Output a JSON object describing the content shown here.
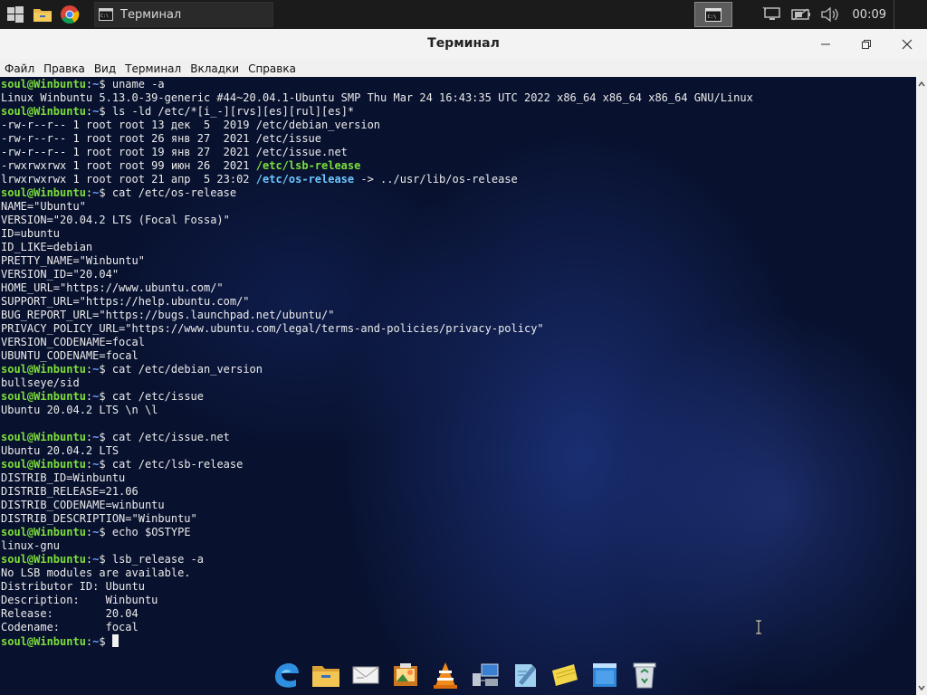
{
  "taskbar": {
    "task_title": "Терминал",
    "clock": "00:09",
    "icons": [
      "windows-start-icon",
      "file-manager-icon",
      "chrome-icon"
    ]
  },
  "window": {
    "title": "Терминал"
  },
  "menu": [
    "Файл",
    "Правка",
    "Вид",
    "Терминал",
    "Вкладки",
    "Справка"
  ],
  "prompt": {
    "user": "soul@Winbuntu",
    "path": "~",
    "symbol": "$ "
  },
  "terminal_lines": [
    {
      "type": "cmd",
      "text": "uname -a"
    },
    {
      "type": "out",
      "text": "Linux Winbuntu 5.13.0-39-generic #44~20.04.1-Ubuntu SMP Thu Mar 24 16:43:35 UTC 2022 x86_64 x86_64 x86_64 GNU/Linux"
    },
    {
      "type": "cmd",
      "text": "ls -ld /etc/*[i_-][rvs][es][rul][es]*"
    },
    {
      "type": "out",
      "text": "-rw-r--r-- 1 root root 13 дек  5  2019 /etc/debian_version"
    },
    {
      "type": "out",
      "text": "-rw-r--r-- 1 root root 26 янв 27  2021 /etc/issue"
    },
    {
      "type": "out",
      "text": "-rw-r--r-- 1 root root 19 янв 27  2021 /etc/issue.net"
    },
    {
      "type": "ls",
      "pre": "-rwxrwxrwx 1 root root 99 июн 26  2021 ",
      "name": "/etc/lsb-release",
      "style": "green",
      "post": ""
    },
    {
      "type": "ls",
      "pre": "lrwxrwxrwx 1 root root 21 апр  5 23:02 ",
      "name": "/etc/os-release",
      "style": "cyan",
      "post": " -> ../usr/lib/os-release"
    },
    {
      "type": "cmd",
      "text": "cat /etc/os-release"
    },
    {
      "type": "out",
      "text": "NAME=\"Ubuntu\""
    },
    {
      "type": "out",
      "text": "VERSION=\"20.04.2 LTS (Focal Fossa)\""
    },
    {
      "type": "out",
      "text": "ID=ubuntu"
    },
    {
      "type": "out",
      "text": "ID_LIKE=debian"
    },
    {
      "type": "out",
      "text": "PRETTY_NAME=\"Winbuntu\""
    },
    {
      "type": "out",
      "text": "VERSION_ID=\"20.04\""
    },
    {
      "type": "out",
      "text": "HOME_URL=\"https://www.ubuntu.com/\""
    },
    {
      "type": "out",
      "text": "SUPPORT_URL=\"https://help.ubuntu.com/\""
    },
    {
      "type": "out",
      "text": "BUG_REPORT_URL=\"https://bugs.launchpad.net/ubuntu/\""
    },
    {
      "type": "out",
      "text": "PRIVACY_POLICY_URL=\"https://www.ubuntu.com/legal/terms-and-policies/privacy-policy\""
    },
    {
      "type": "out",
      "text": "VERSION_CODENAME=focal"
    },
    {
      "type": "out",
      "text": "UBUNTU_CODENAME=focal"
    },
    {
      "type": "cmd",
      "text": "cat /etc/debian_version"
    },
    {
      "type": "out",
      "text": "bullseye/sid"
    },
    {
      "type": "cmd",
      "text": "cat /etc/issue"
    },
    {
      "type": "out",
      "text": "Ubuntu 20.04.2 LTS \\n \\l"
    },
    {
      "type": "out",
      "text": ""
    },
    {
      "type": "cmd",
      "text": "cat /etc/issue.net"
    },
    {
      "type": "out",
      "text": "Ubuntu 20.04.2 LTS"
    },
    {
      "type": "cmd",
      "text": "cat /etc/lsb-release"
    },
    {
      "type": "out",
      "text": "DISTRIB_ID=Winbuntu"
    },
    {
      "type": "out",
      "text": "DISTRIB_RELEASE=21.06"
    },
    {
      "type": "out",
      "text": "DISTRIB_CODENAME=winbuntu"
    },
    {
      "type": "out",
      "text": "DISTRIB_DESCRIPTION=\"Winbuntu\""
    },
    {
      "type": "cmd",
      "text": "echo $OSTYPE"
    },
    {
      "type": "out",
      "text": "linux-gnu"
    },
    {
      "type": "cmd",
      "text": "lsb_release -a"
    },
    {
      "type": "out",
      "text": "No LSB modules are available."
    },
    {
      "type": "out",
      "text": "Distributor ID:\tUbuntu"
    },
    {
      "type": "out",
      "text": "Description:\tWinbuntu"
    },
    {
      "type": "out",
      "text": "Release:\t20.04"
    },
    {
      "type": "out",
      "text": "Codename:\tfocal"
    },
    {
      "type": "input",
      "text": ""
    }
  ],
  "dock": [
    "edge-icon",
    "folder-icon",
    "mail-icon",
    "image-viewer-icon",
    "vlc-icon",
    "network-computer-icon",
    "text-editor-icon",
    "notes-icon",
    "window-app-icon",
    "recycle-bin-icon"
  ],
  "colors": {
    "prompt_green": "#7cdf3a",
    "prompt_blue": "#6fa0ff",
    "symlink_cyan": "#6fc7ff"
  }
}
